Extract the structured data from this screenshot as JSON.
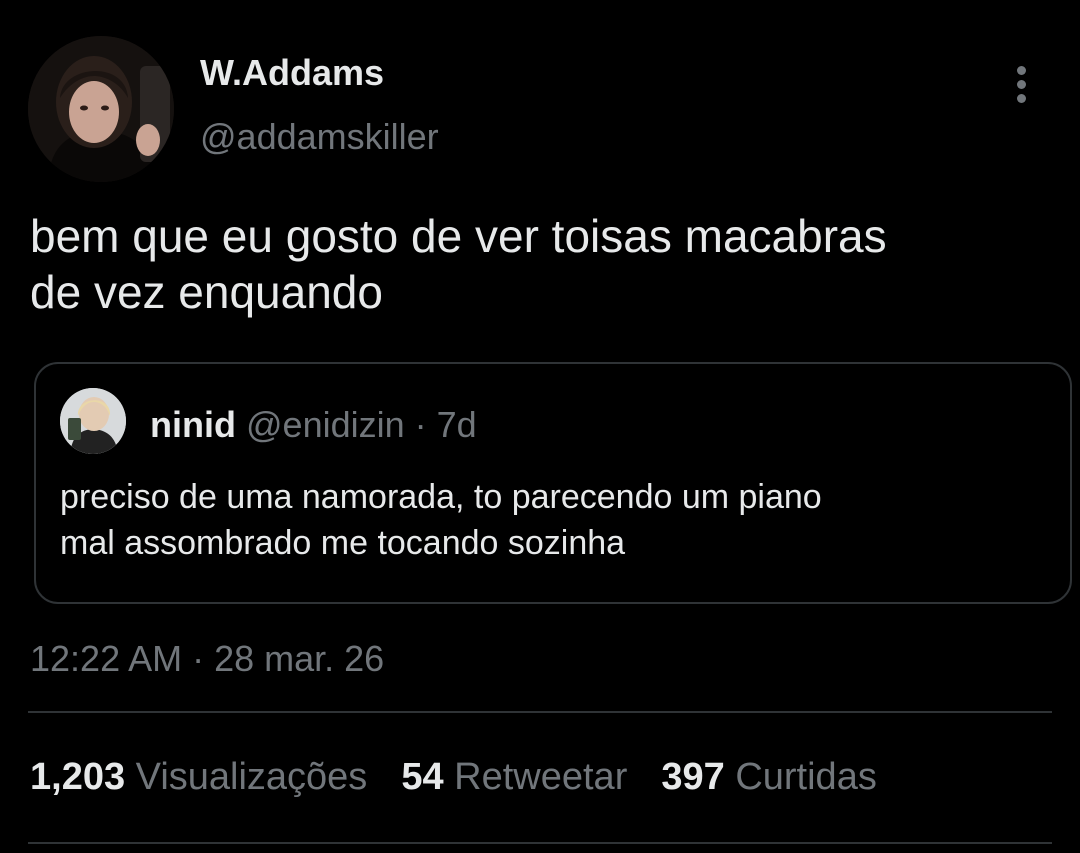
{
  "author": {
    "display_name": "W.Addams",
    "handle": "@addamskiller"
  },
  "more_icon": "more-vertical-icon",
  "tweet": {
    "line1": "bem que eu gosto de ver toisas macabras",
    "line2": "de vez enquando"
  },
  "quote": {
    "name": "ninid",
    "handle": "@enidizin",
    "separator": "·",
    "age": "7d",
    "line1": "preciso de uma namorada, to parecendo um piano",
    "line2": "mal assombrado me tocando sozinha"
  },
  "timestamp": "12:22 AM · 28 mar. 26",
  "stats": {
    "views_count": "1,203",
    "views_label": "Visualizações",
    "retweets_count": "54",
    "retweets_label": "Retweetar",
    "likes_count": "397",
    "likes_label": "Curtidas"
  },
  "colors": {
    "background": "#000000",
    "text_primary": "#e7e9ea",
    "text_secondary": "#71767b",
    "border": "#2f3336"
  }
}
